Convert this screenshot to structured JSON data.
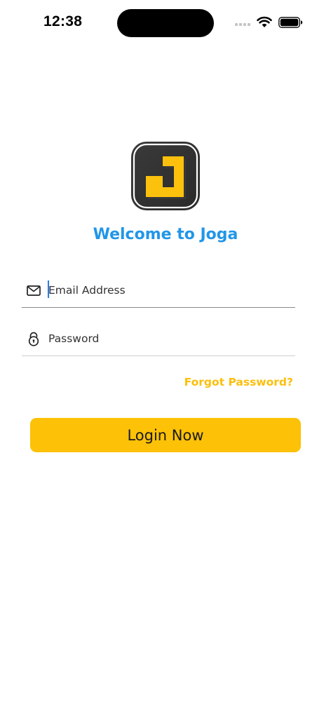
{
  "status_bar": {
    "time": "12:38"
  },
  "app": {
    "welcome_text": "Welcome to Joga",
    "logo_icon": "joga-logo-icon"
  },
  "form": {
    "email": {
      "placeholder": "Email Address",
      "value": "",
      "icon": "mail-icon"
    },
    "password": {
      "placeholder": "Password",
      "value": "",
      "icon": "lock-icon"
    },
    "forgot_label": "Forgot Password?",
    "login_label": "Login Now"
  },
  "colors": {
    "accent_blue": "#2196e8",
    "accent_yellow": "#fdc107",
    "logo_background": "#333333"
  }
}
